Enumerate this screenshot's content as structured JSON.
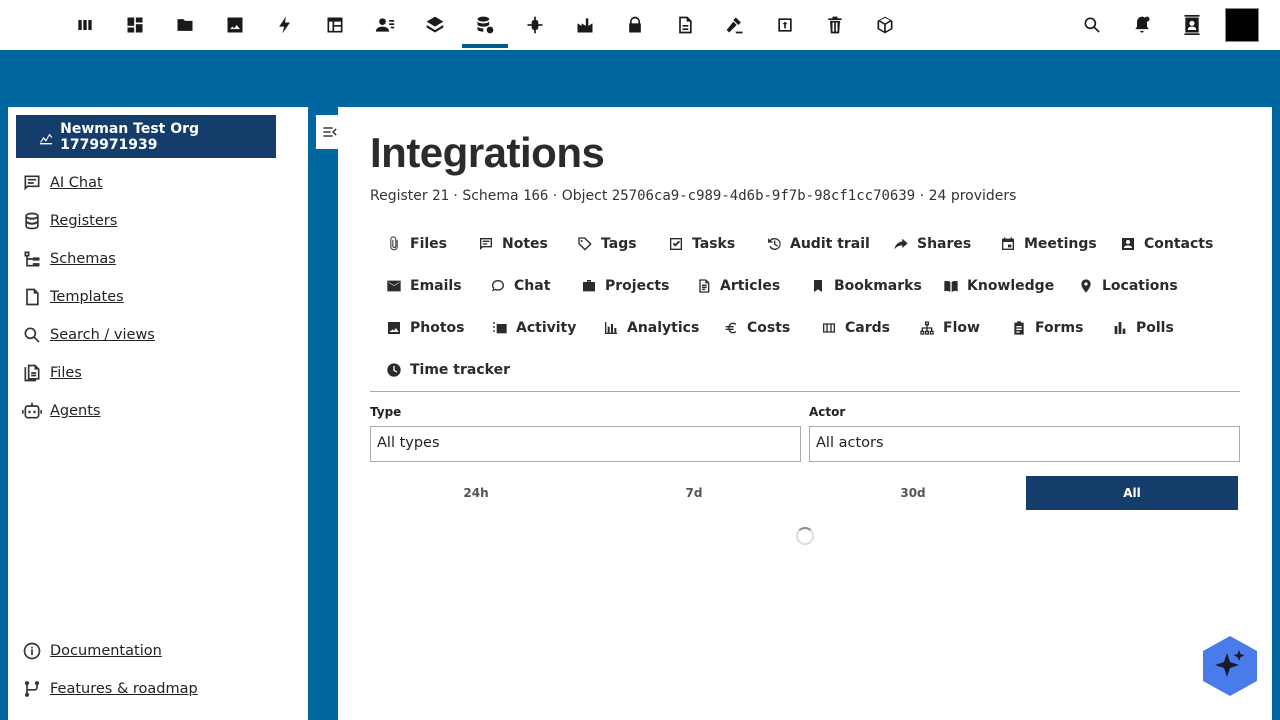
{
  "topbar": {
    "apps": [
      {
        "icon": "columns-icon",
        "name": "apps"
      },
      {
        "icon": "dashboard-icon",
        "name": "dashboard"
      },
      {
        "icon": "folder-icon",
        "name": "files"
      },
      {
        "icon": "image-icon",
        "name": "photos"
      },
      {
        "icon": "lightning-icon",
        "name": "activity"
      },
      {
        "icon": "table-icon",
        "name": "tables"
      },
      {
        "icon": "contacts-icon",
        "name": "contacts"
      },
      {
        "icon": "layers-icon",
        "name": "layers"
      },
      {
        "icon": "database-icon",
        "name": "registers"
      },
      {
        "icon": "bug-icon",
        "name": "debug"
      },
      {
        "icon": "factory-icon",
        "name": "factory"
      },
      {
        "icon": "lock-icon",
        "name": "passwords"
      },
      {
        "icon": "document-icon",
        "name": "documents"
      },
      {
        "icon": "gavel-icon",
        "name": "decisions"
      },
      {
        "icon": "export-icon",
        "name": "export"
      },
      {
        "icon": "trash-icon",
        "name": "deleted"
      },
      {
        "icon": "cube-icon",
        "name": "objects"
      }
    ],
    "active_app": "registers",
    "right_icons": [
      "search-icon",
      "notifications-icon",
      "contacts-menu-icon"
    ]
  },
  "sidebar": {
    "org_name": "Newman Test Org 1779971939",
    "items": [
      {
        "label": "AI Chat",
        "icon": "chat-icon"
      },
      {
        "label": "Registers",
        "icon": "database-icon"
      },
      {
        "label": "Schemas",
        "icon": "schema-icon"
      },
      {
        "label": "Templates",
        "icon": "template-icon"
      },
      {
        "label": "Search / views",
        "icon": "search-icon"
      },
      {
        "label": "Files",
        "icon": "files-icon"
      },
      {
        "label": "Agents",
        "icon": "robot-icon"
      }
    ],
    "footer_items": [
      {
        "label": "Documentation",
        "icon": "info-icon"
      },
      {
        "label": "Features & roadmap",
        "icon": "roadmap-icon"
      }
    ]
  },
  "main": {
    "title": "Integrations",
    "meta": {
      "register_label": "Register",
      "register_id": "21",
      "schema_label": "Schema",
      "schema_id": "166",
      "object_label": "Object",
      "object_id": "25706ca9-c989-4d6b-9f7b-98cf1cc70639",
      "providers": "24 providers",
      "separator": " · "
    },
    "tabs": [
      {
        "label": "Files",
        "icon": "paperclip-icon"
      },
      {
        "label": "Notes",
        "icon": "note-icon"
      },
      {
        "label": "Tags",
        "icon": "tag-icon"
      },
      {
        "label": "Tasks",
        "icon": "checkbox-icon"
      },
      {
        "label": "Audit trail",
        "icon": "history-icon"
      },
      {
        "label": "Shares",
        "icon": "share-icon"
      },
      {
        "label": "Meetings",
        "icon": "calendar-icon"
      },
      {
        "label": "Contacts",
        "icon": "contact-card-icon"
      },
      {
        "label": "Emails",
        "icon": "mail-icon"
      },
      {
        "label": "Chat",
        "icon": "chat-bubble-icon"
      },
      {
        "label": "Projects",
        "icon": "briefcase-icon"
      },
      {
        "label": "Articles",
        "icon": "article-icon"
      },
      {
        "label": "Bookmarks",
        "icon": "bookmark-icon"
      },
      {
        "label": "Knowledge",
        "icon": "book-icon"
      },
      {
        "label": "Locations",
        "icon": "pin-icon"
      },
      {
        "label": "Photos",
        "icon": "photo-icon"
      },
      {
        "label": "Activity",
        "icon": "timeline-icon"
      },
      {
        "label": "Analytics",
        "icon": "analytics-icon"
      },
      {
        "label": "Costs",
        "icon": "euro-icon"
      },
      {
        "label": "Cards",
        "icon": "columns-icon"
      },
      {
        "label": "Flow",
        "icon": "sitemap-icon"
      },
      {
        "label": "Forms",
        "icon": "clipboard-icon"
      },
      {
        "label": "Polls",
        "icon": "poll-icon"
      },
      {
        "label": "Time tracker",
        "icon": "clock-icon"
      }
    ],
    "filters": {
      "type_label": "Type",
      "type_value": "All types",
      "actor_label": "Actor",
      "actor_value": "All actors"
    },
    "ranges": [
      "24h",
      "7d",
      "30d",
      "All"
    ],
    "active_range": "All"
  },
  "colors": {
    "brand": "#0066a0",
    "accent": "#143d6b",
    "fab": "#4a7bea"
  }
}
